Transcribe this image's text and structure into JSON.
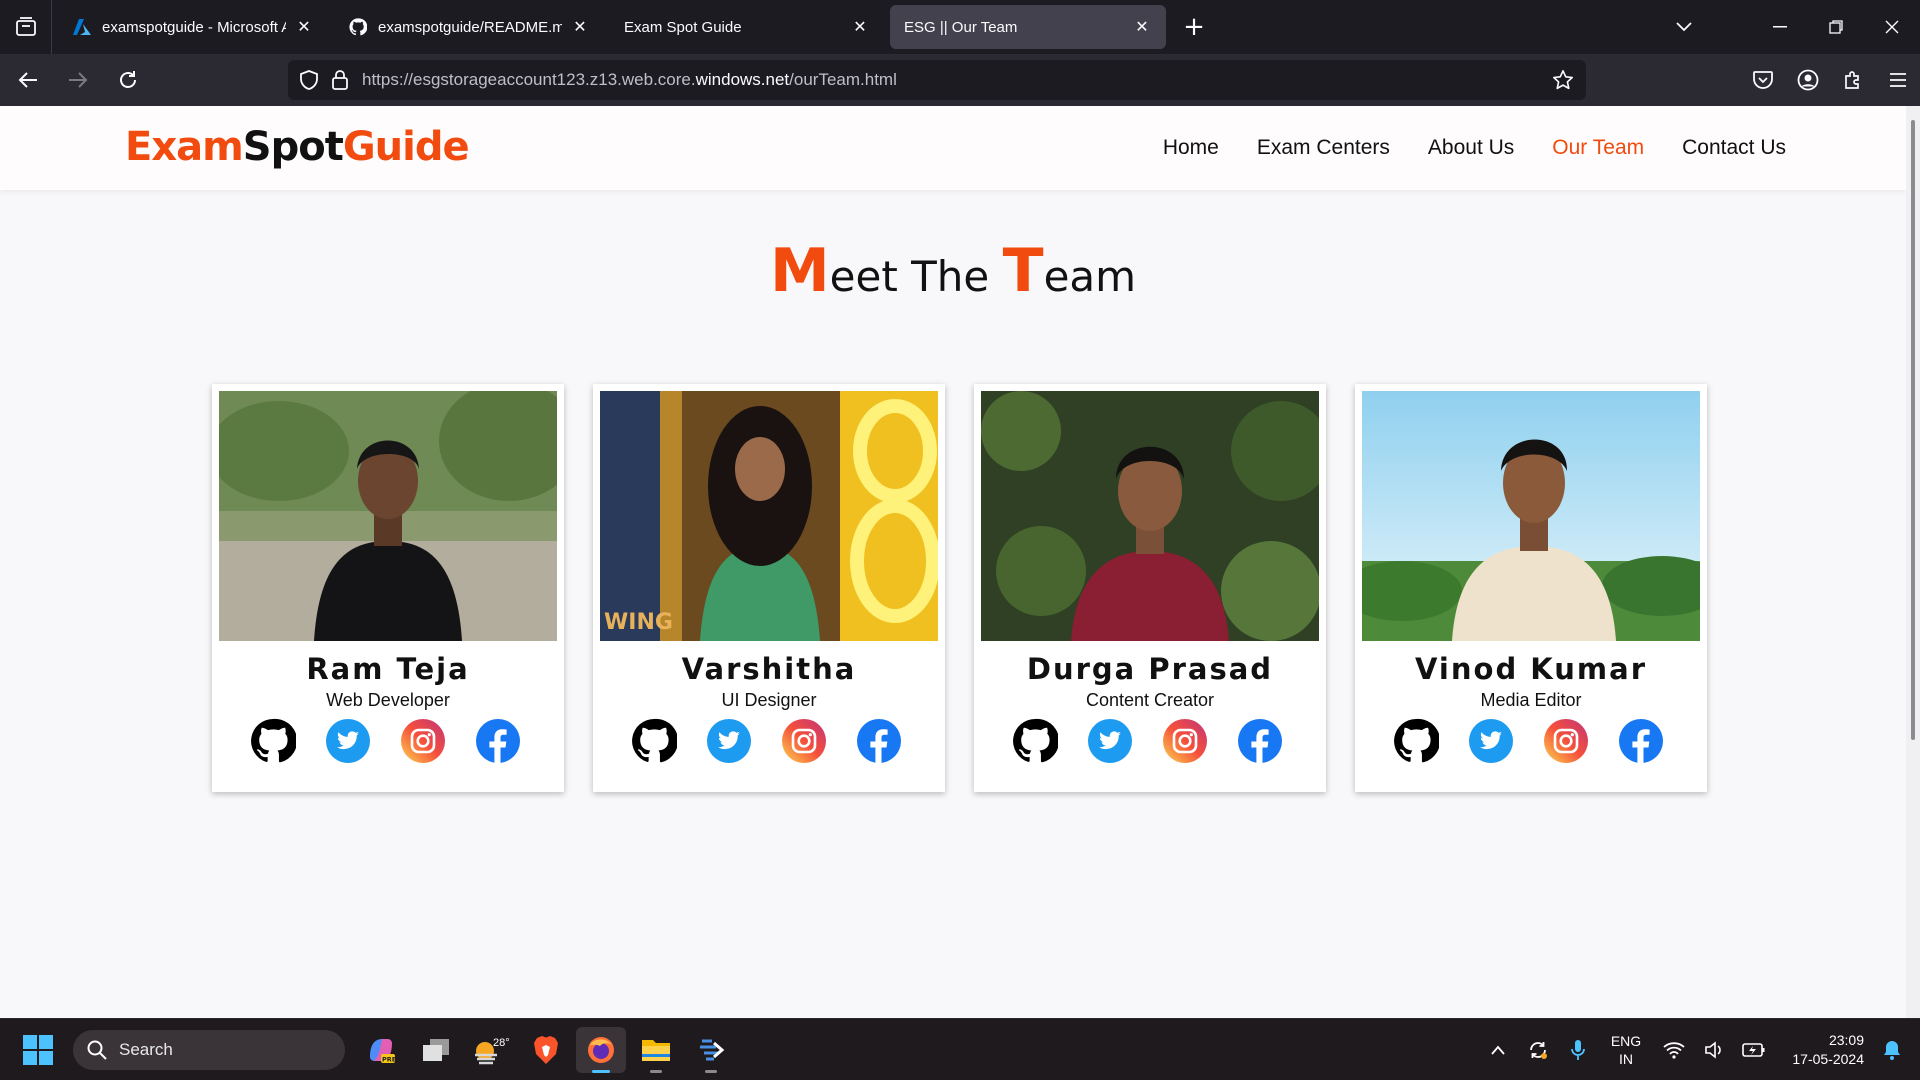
{
  "browser": {
    "tabs": [
      {
        "title": "examspotguide - Microsoft Azu",
        "icon": "azure-icon",
        "active": false
      },
      {
        "title": "examspotguide/README.md a",
        "icon": "github-icon",
        "active": false
      },
      {
        "title": "Exam Spot Guide",
        "icon": "none",
        "active": false
      },
      {
        "title": "ESG || Our Team",
        "icon": "none",
        "active": true
      }
    ],
    "url_prefix": "https://esgstorageaccount123.z13.web.core.",
    "url_domain": "windows.net",
    "url_path": "/ourTeam.html"
  },
  "site": {
    "logo": {
      "part1": "Exam",
      "part2": "Spot",
      "part3": "Guide"
    },
    "menu": [
      "Home",
      "Exam Centers",
      "About Us",
      "Our Team",
      "Contact Us"
    ],
    "current_menu": "Our Team",
    "heading": {
      "m": "M",
      "eet": "eet The ",
      "t": "T",
      "eam": "eam"
    },
    "team": [
      {
        "name": "Ram Teja",
        "role": "Web Developer"
      },
      {
        "name": "Varshitha",
        "role": "UI Designer"
      },
      {
        "name": "Durga Prasad",
        "role": "Content Creator"
      },
      {
        "name": "Vinod Kumar",
        "role": "Media Editor"
      }
    ],
    "social_icons": [
      "github-icon",
      "twitter-icon",
      "instagram-icon",
      "facebook-icon"
    ],
    "colors": {
      "accent": "#f24b0f",
      "twitter": "#1d9bf0",
      "facebook": "#1877f2"
    }
  },
  "taskbar": {
    "search_label": "Search",
    "weather": "28°",
    "lang_line1": "ENG",
    "lang_line2": "IN",
    "time": "23:09",
    "date": "17-05-2024"
  }
}
